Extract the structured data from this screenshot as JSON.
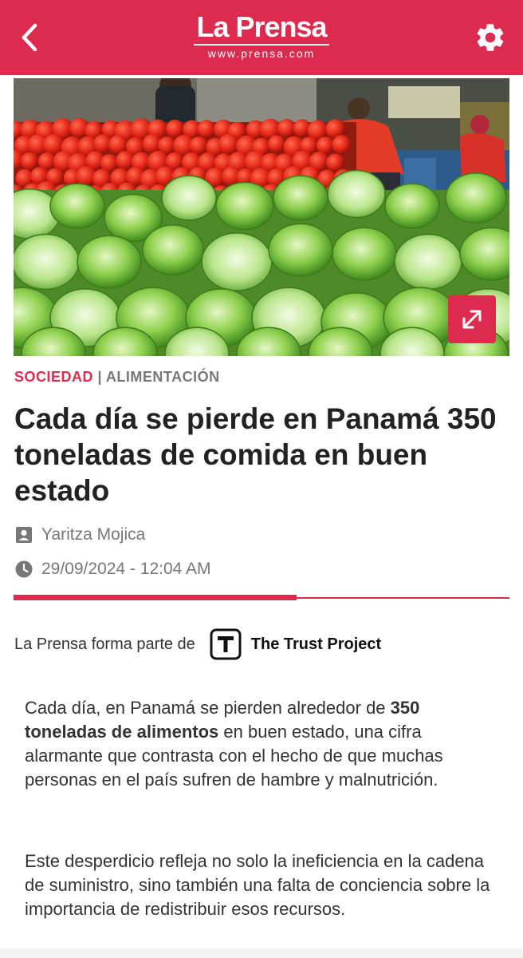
{
  "header": {
    "logo_title": "La Prensa",
    "logo_url": "www.prensa.com",
    "back_icon": "chevron-left-icon",
    "settings_icon": "gear-icon",
    "color": "#dd2a4f"
  },
  "hero": {
    "expand_icon": "expand-arrows-icon"
  },
  "article": {
    "category": "SOCIEDAD",
    "separator": "|",
    "subcategory": "ALIMENTACIÓN",
    "headline": "Cada día se pierde en Panamá 350 toneladas de comida en buen estado",
    "author": "Yaritza Mojica",
    "date": "29/09/2024 - 12:04 AM",
    "reading_progress": 0.57
  },
  "trust": {
    "text": "La Prensa forma parte de",
    "name": "The Trust Project"
  },
  "body": {
    "p1_start": "Cada día, en Panamá se pierden alrededor de",
    "p1_bold": "350 toneladas de alimentos",
    "p1_end": "en buen estado, una cifra alarmante que contrasta con el hecho de que muchas personas en el país sufren de hambre y malnutrición.",
    "p2": "Este desperdicio refleja no solo la ineficiencia en la cadena de suministro, sino también una falta de conciencia sobre la importancia de redistribuir esos recursos."
  }
}
